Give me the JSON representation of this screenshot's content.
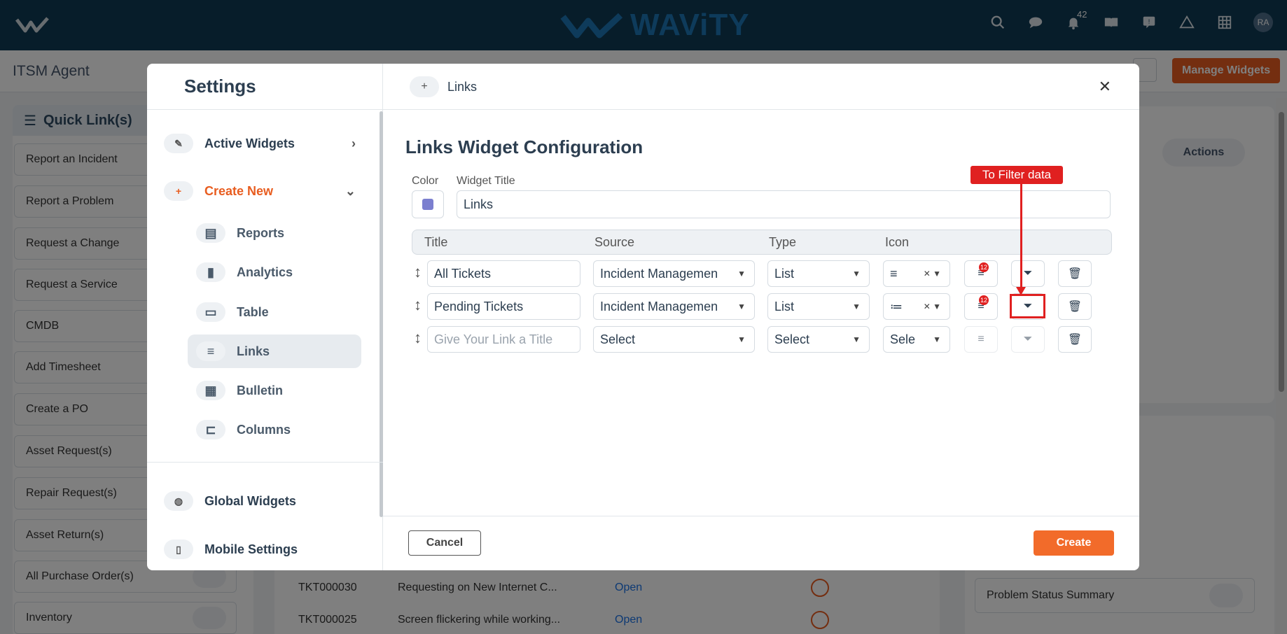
{
  "header": {
    "brand": "WAViTY",
    "notifications": "42",
    "avatar": "RA"
  },
  "subbar": {
    "title": "ITSM Agent",
    "manage_widgets": "Manage Widgets"
  },
  "quick_links": {
    "title": "Quick Link(s)",
    "items": [
      "Report an Incident",
      "Report a Problem",
      "Request a Change",
      "Request a Service",
      "CMDB",
      "Add Timesheet",
      "Create a PO",
      "Asset Request(s)",
      "Repair Request(s)",
      "Asset Return(s)",
      "All Purchase Order(s)",
      "Inventory"
    ]
  },
  "tickets": [
    {
      "id": "TKT000030",
      "desc": "Requesting on New Internet C...",
      "status": "Open"
    },
    {
      "id": "TKT000025",
      "desc": "Screen flickering while working...",
      "status": "Open"
    }
  ],
  "right_panel": {
    "actions": "Actions",
    "reports": [
      "Problem Status Summary"
    ]
  },
  "modal": {
    "settings_title": "Settings",
    "nav": {
      "active_widgets": "Active Widgets",
      "create_new": "Create New",
      "global_widgets": "Global Widgets",
      "mobile_settings": "Mobile Settings"
    },
    "sub_items": [
      "Reports",
      "Analytics",
      "Table",
      "Links",
      "Bulletin",
      "Columns"
    ],
    "tab": "Links",
    "config_title": "Links Widget Configuration",
    "color_label": "Color",
    "widget_title_label": "Widget Title",
    "widget_title_value": "Links",
    "color": "#7b7fcf",
    "columns": {
      "title": "Title",
      "source": "Source",
      "type": "Type",
      "icon": "Icon"
    },
    "rows": [
      {
        "title": "All Tickets",
        "source": "Incident Managemen",
        "type": "List",
        "icon": "",
        "count": "12"
      },
      {
        "title": "Pending Tickets",
        "source": "Incident Managemen",
        "type": "List",
        "icon": "",
        "count": "12"
      }
    ],
    "new_row": {
      "title_placeholder": "Give Your Link a Title",
      "source": "Select",
      "type": "Select",
      "icon": "Sele"
    },
    "cancel": "Cancel",
    "create": "Create"
  },
  "annotation": {
    "label": "To Filter data",
    "color": "#e02020"
  }
}
